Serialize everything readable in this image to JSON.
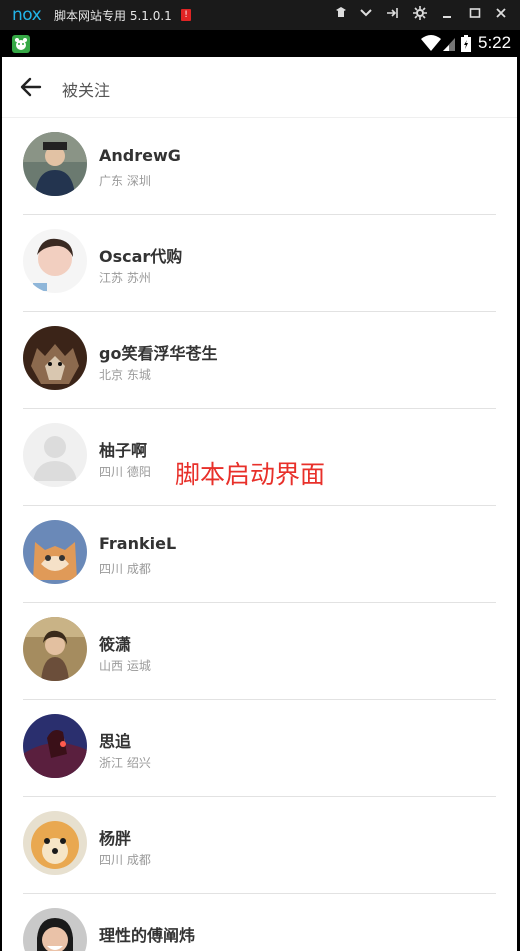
{
  "emulator": {
    "logo": "nox",
    "title": "脚本网站专用 5.1.0.1",
    "alert": "!"
  },
  "status_bar": {
    "time": "5:22"
  },
  "header": {
    "title": "被关注"
  },
  "users": [
    {
      "name": "AndrewG",
      "location": "广东 深圳"
    },
    {
      "name": "Oscar代购",
      "location": "江苏 苏州"
    },
    {
      "name": "go笑看浮华苍生",
      "location": "北京 东城"
    },
    {
      "name": "柚子啊",
      "location": "四川 德阳"
    },
    {
      "name": "FrankieL",
      "location": "四川 成都"
    },
    {
      "name": "筱潇",
      "location": "山西 运城"
    },
    {
      "name": "思追",
      "location": "浙江 绍兴"
    },
    {
      "name": "杨胖",
      "location": "四川 成都"
    },
    {
      "name": "理性的傅阐炜",
      "location": ""
    }
  ],
  "overlay_text": "脚本启动界面",
  "colors": {
    "accent_blue": "#22b4e8",
    "overlay_red": "#e8302a",
    "notification_green": "#35a845"
  }
}
